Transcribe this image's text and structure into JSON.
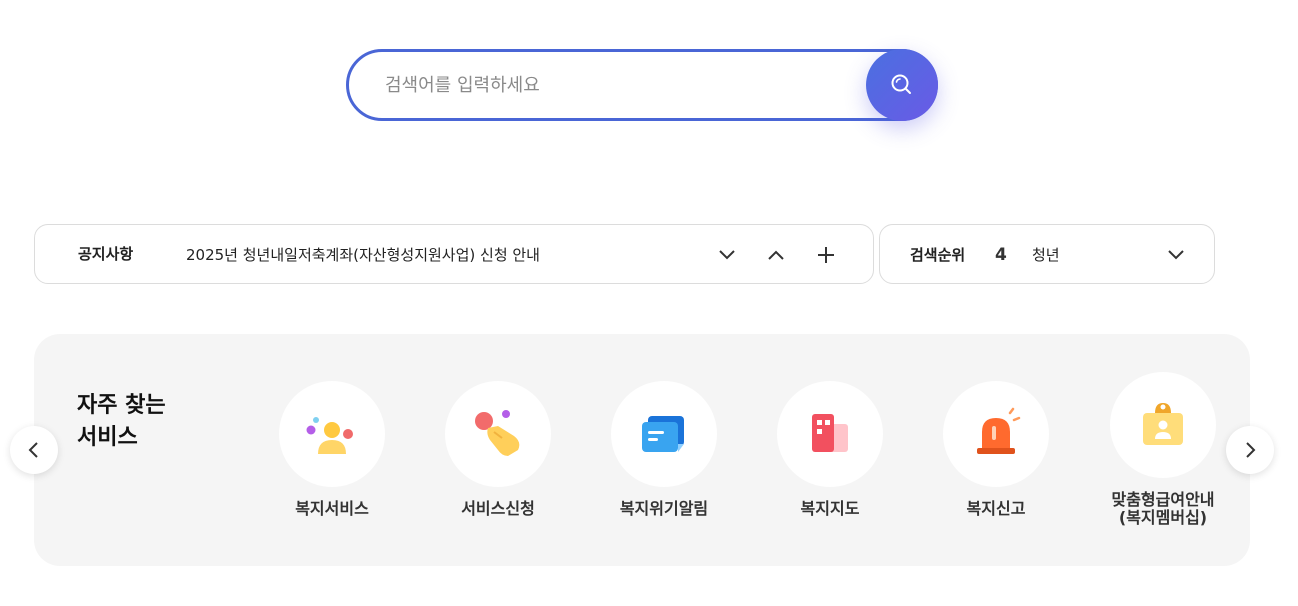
{
  "search": {
    "placeholder": "검색어를 입력하세요",
    "value": "",
    "button_icon": "search-icon",
    "accent_color": "#4a66d6"
  },
  "notice": {
    "label": "공지사항",
    "text": "2025년 청년내일저축계좌(자산형성지원사업) 신청 안내",
    "controls": [
      "chevron-down-icon",
      "chevron-up-icon",
      "plus-icon"
    ]
  },
  "search_rank": {
    "label": "검색순위",
    "rank": "4",
    "keyword": "청년",
    "control": "chevron-down-icon"
  },
  "frequent_services": {
    "title": "자주 찾는\n서비스",
    "items": [
      {
        "label": "복지서비스",
        "icon": "people-icon"
      },
      {
        "label": "서비스신청",
        "icon": "hand-click-icon"
      },
      {
        "label": "복지위기알림",
        "icon": "message-icon"
      },
      {
        "label": "복지지도",
        "icon": "building-map-icon"
      },
      {
        "label": "복지신고",
        "icon": "siren-icon"
      },
      {
        "label": "맞춤형급여안내\n(복지멤버십)",
        "icon": "membership-badge-icon"
      }
    ],
    "prev_icon": "chevron-left-icon",
    "next_icon": "chevron-right-icon"
  }
}
